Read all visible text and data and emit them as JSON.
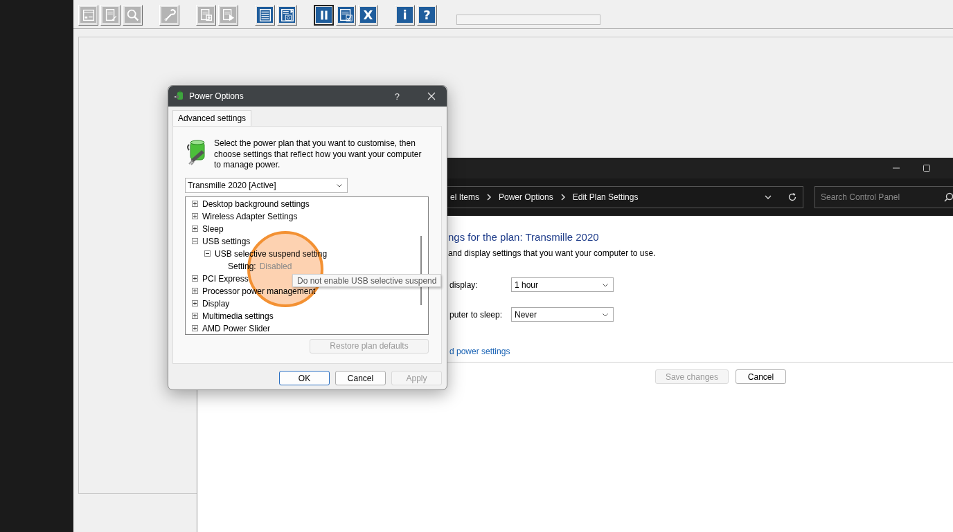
{
  "toolbar": {
    "groups": [
      [
        {
          "kind": "window",
          "disabled": true,
          "pressed": false
        },
        {
          "kind": "document-edit",
          "disabled": true,
          "pressed": false
        },
        {
          "kind": "search",
          "disabled": true,
          "pressed": false
        }
      ],
      [
        {
          "kind": "wrench",
          "disabled": true,
          "pressed": false
        }
      ],
      [
        {
          "kind": "document-export",
          "disabled": true,
          "pressed": false
        },
        {
          "kind": "document-play",
          "disabled": true,
          "pressed": false
        }
      ],
      [
        {
          "kind": "list",
          "disabled": false,
          "pressed": false
        },
        {
          "kind": "form",
          "disabled": false,
          "pressed": false
        }
      ],
      [
        {
          "kind": "pause",
          "disabled": false,
          "pressed": true
        },
        {
          "kind": "checklist",
          "disabled": false,
          "pressed": false
        },
        {
          "kind": "glyph",
          "glyph": "X",
          "disabled": false,
          "pressed": false
        }
      ],
      [
        {
          "kind": "glyph",
          "glyph": "i",
          "disabled": false,
          "pressed": false
        },
        {
          "kind": "glyph",
          "glyph": "?",
          "disabled": false,
          "pressed": false
        }
      ]
    ],
    "progress": {
      "level": 0
    }
  },
  "control_panel": {
    "breadcrumb": [
      "el Items",
      "Power Options",
      "Edit Plan Settings"
    ],
    "search": {
      "placeholder": "Search Control Panel"
    },
    "heading": "ngs for the plan: Transmille 2020",
    "subtitle": "and display settings that you want your computer to use.",
    "settings": [
      {
        "label": "display:",
        "value": "1 hour"
      },
      {
        "label": "puter to sleep:",
        "value": "Never"
      }
    ],
    "link": "d power settings",
    "buttons": [
      {
        "label": "Save changes",
        "disabled": true
      },
      {
        "label": "Cancel",
        "disabled": false
      }
    ]
  },
  "power_options_dialog": {
    "title": "Power Options",
    "help_button": "?",
    "tabs": [
      {
        "label": "Advanced settings",
        "selected": true
      }
    ],
    "intro": "Select the power plan that you want to customise, then choose settings that reflect how you want your computer to manage power.",
    "plan_dropdown": {
      "value": "Transmille 2020 [Active]"
    },
    "tree": [
      {
        "kind": "group",
        "label": "Desktop background settings",
        "expanded": false
      },
      {
        "kind": "group",
        "label": "Wireless Adapter Settings",
        "expanded": false
      },
      {
        "kind": "group",
        "label": "Sleep",
        "expanded": false
      },
      {
        "kind": "group",
        "label": "USB settings",
        "expanded": true,
        "children": [
          {
            "kind": "group",
            "label": "USB selective suspend setting",
            "expanded": true,
            "children": [
              {
                "kind": "setting",
                "label": "Setting:",
                "value": "Disabled"
              }
            ]
          }
        ]
      },
      {
        "kind": "group",
        "label": "PCI Express",
        "expanded": false
      },
      {
        "kind": "group",
        "label": "Processor power management",
        "expanded": false
      },
      {
        "kind": "group",
        "label": "Display",
        "expanded": false
      },
      {
        "kind": "group",
        "label": "Multimedia settings",
        "expanded": false
      },
      {
        "kind": "group",
        "label": "AMD Power Slider",
        "expanded": false
      }
    ],
    "tooltip": "Do not enable USB selective suspend",
    "restore_button": {
      "label": "Restore plan defaults",
      "disabled": true
    },
    "buttons": [
      {
        "label": "OK",
        "default": true,
        "disabled": false
      },
      {
        "label": "Cancel",
        "default": false,
        "disabled": false
      },
      {
        "label": "Apply",
        "default": false,
        "disabled": true
      }
    ]
  }
}
